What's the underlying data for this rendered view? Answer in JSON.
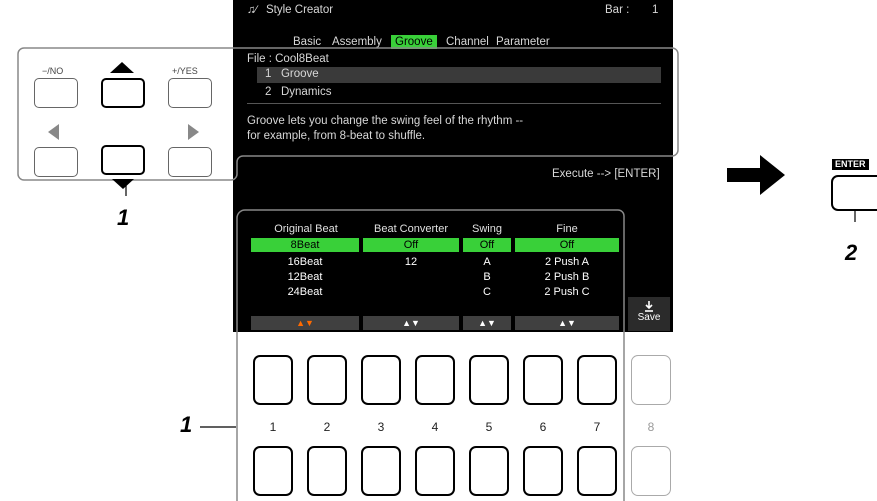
{
  "screen": {
    "title": "Style Creator",
    "bar_label": "Bar :",
    "bar_value": "1",
    "tabs": [
      "Basic",
      "Assembly",
      "Groove",
      "Channel",
      "Parameter"
    ],
    "active_tab": "Groove",
    "file_label": "File : Cool8Beat",
    "menu": [
      "1   Groove",
      "2   Dynamics"
    ],
    "description_line1": "Groove lets you change the swing feel of the rhythm --",
    "description_line2": "for example, from 8-beat to shuffle.",
    "execute_hint": "Execute --> [ENTER]",
    "columns": {
      "original_beat": {
        "header": "Original Beat",
        "selected": "8Beat",
        "items": [
          "16Beat",
          "12Beat",
          "24Beat"
        ]
      },
      "beat_converter": {
        "header": "Beat Converter",
        "selected": "Off",
        "items": [
          "12"
        ]
      },
      "swing": {
        "header": "Swing",
        "selected": "Off",
        "items": [
          "A",
          "B",
          "C"
        ]
      },
      "fine": {
        "header": "Fine",
        "selected": "Off",
        "items": [
          "2 Push A",
          "2 Push B",
          "2 Push C"
        ]
      }
    },
    "arrow_glyph": "▲▼",
    "save_label": "Save",
    "save_icon": "download-icon"
  },
  "panel": {
    "no_label": "−/NO",
    "yes_label": "+/YES"
  },
  "button_numbers": [
    "1",
    "2",
    "3",
    "4",
    "5",
    "6",
    "7",
    "8"
  ],
  "enter_label": "ENTER",
  "callouts": {
    "panel": "1",
    "buttons": "1",
    "enter": "2"
  },
  "colors": {
    "highlight": "#39d039",
    "orange": "#ff6a00",
    "screen_bg": "#000000"
  }
}
